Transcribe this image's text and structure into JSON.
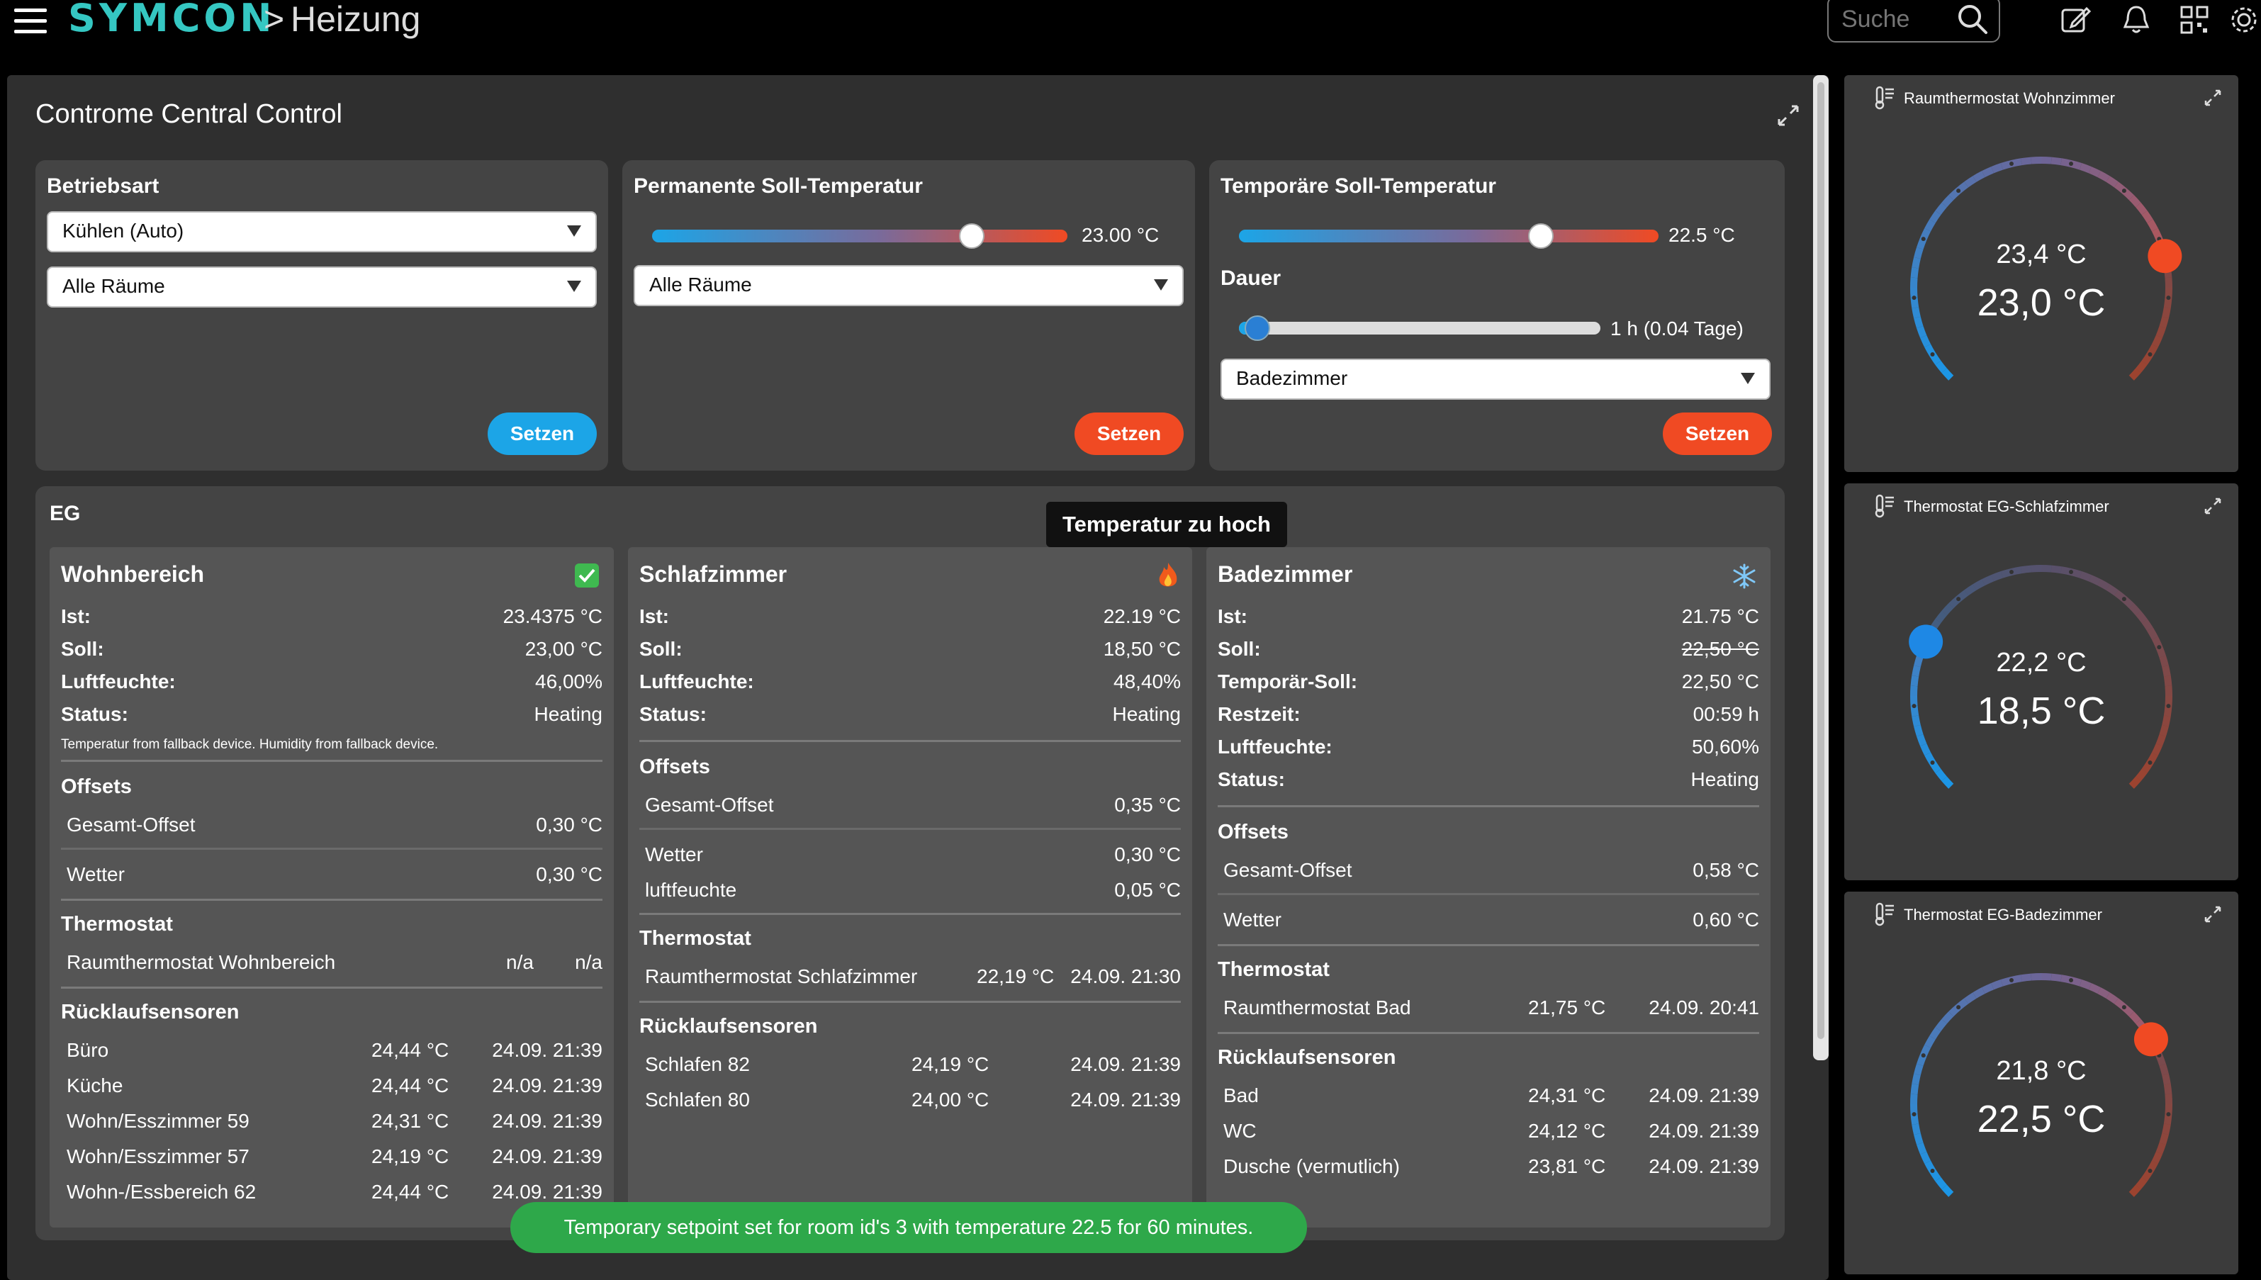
{
  "header": {
    "logo": "SYMCON",
    "breadcrumb_sep": ">",
    "breadcrumb": "Heizung",
    "search_placeholder": "Suche"
  },
  "icons": {
    "menu": "menu-icon",
    "search": "search-icon",
    "edit": "edit-icon",
    "bell": "bell-icon",
    "qr": "qr-code-icon",
    "settings": "gear-icon",
    "expand": "expand-icon",
    "thermometer": "thermometer-icon",
    "ok": "check-mark-icon",
    "fire": "fire-icon",
    "snow": "snowflake-icon"
  },
  "colors": {
    "accent_blue": "#1ca5e7",
    "accent_red": "#f04a23",
    "logo": "#35c7c2",
    "toast": "#2ea84a"
  },
  "main": {
    "title": "Controme Central Control",
    "betriebsart": {
      "title": "Betriebsart",
      "mode_select": "Kühlen (Auto)",
      "room_select": "Alle Räume",
      "button": "Setzen"
    },
    "permanent": {
      "title": "Permanente Soll-Temperatur",
      "value": "23.00 °C",
      "slider_fraction": 0.77,
      "room_select": "Alle Räume",
      "button": "Setzen"
    },
    "temporary": {
      "title": "Temporäre Soll-Temperatur",
      "value": "22.5 °C",
      "slider_fraction": 0.72,
      "duration_title": "Dauer",
      "duration_value": "1 h (0.04 Tage)",
      "duration_fraction": 0.05,
      "room_select": "Badezimmer",
      "button": "Setzen"
    }
  },
  "eg": {
    "title": "EG",
    "tooltip": "Temperatur zu hoch",
    "rooms": [
      {
        "title": "Wohnbereich",
        "status_icon": "check-mark-icon",
        "rows": [
          {
            "k": "Ist:",
            "v": "23.4375 °C"
          },
          {
            "k": "Soll:",
            "v": "23,00 °C"
          },
          {
            "k": "Luftfeuchte:",
            "v": "46,00%"
          },
          {
            "k": "Status:",
            "v": "Heating"
          }
        ],
        "note": "Temperatur from fallback device. Humidity from fallback device.",
        "offsets_title": "Offsets",
        "offsets": [
          {
            "k": "Gesamt-Offset",
            "v": "0,30 °C"
          },
          {
            "k": "Wetter",
            "v": "0,30 °C"
          }
        ],
        "thermostat_title": "Thermostat",
        "thermostat": {
          "name": "Raumthermostat Wohnbereich",
          "temp": "n/a",
          "time": "n/a"
        },
        "sensors_title": "Rücklaufsensoren",
        "sensors": [
          {
            "name": "Büro",
            "temp": "24,44 °C",
            "time": "24.09. 21:39"
          },
          {
            "name": "Küche",
            "temp": "24,44 °C",
            "time": "24.09. 21:39"
          },
          {
            "name": "Wohn/Esszimmer 59",
            "temp": "24,31 °C",
            "time": "24.09. 21:39"
          },
          {
            "name": "Wohn/Esszimmer 57",
            "temp": "24,19 °C",
            "time": "24.09. 21:39"
          },
          {
            "name": "Wohn-/Essbereich 62",
            "temp": "24,44 °C",
            "time": "24.09. 21:39"
          }
        ]
      },
      {
        "title": "Schlafzimmer",
        "status_icon": "fire-icon",
        "rows": [
          {
            "k": "Ist:",
            "v": "22.19 °C"
          },
          {
            "k": "Soll:",
            "v": "18,50 °C"
          },
          {
            "k": "Luftfeuchte:",
            "v": "48,40%"
          },
          {
            "k": "Status:",
            "v": "Heating"
          }
        ],
        "offsets_title": "Offsets",
        "offsets": [
          {
            "k": "Gesamt-Offset",
            "v": "0,35 °C"
          },
          {
            "k": "Wetter",
            "v": "0,30 °C"
          },
          {
            "k": "luftfeuchte",
            "v": "0,05 °C"
          }
        ],
        "thermostat_title": "Thermostat",
        "thermostat": {
          "name": "Raumthermostat Schlafzimmer",
          "temp": "22,19 °C",
          "time": "24.09. 21:30"
        },
        "sensors_title": "Rücklaufsensoren",
        "sensors": [
          {
            "name": "Schlafen 82",
            "temp": "24,19 °C",
            "time": "24.09. 21:39"
          },
          {
            "name": "Schlafen 80",
            "temp": "24,00 °C",
            "time": "24.09. 21:39"
          }
        ]
      },
      {
        "title": "Badezimmer",
        "status_icon": "snowflake-icon",
        "rows": [
          {
            "k": "Ist:",
            "v": "21.75 °C"
          },
          {
            "k": "Soll:",
            "v": "22,50 °C"
          },
          {
            "k": "Temporär-Soll:",
            "v": "22,50 °C"
          },
          {
            "k": "Restzeit:",
            "v": "00:59 h"
          },
          {
            "k": "Luftfeuchte:",
            "v": "50,60%"
          },
          {
            "k": "Status:",
            "v": "Heating"
          }
        ],
        "offsets_title": "Offsets",
        "offsets": [
          {
            "k": "Gesamt-Offset",
            "v": "0,58 °C"
          },
          {
            "k": "Wetter",
            "v": "0,60 °C"
          }
        ],
        "thermostat_title": "Thermostat",
        "thermostat": {
          "name": "Raumthermostat Bad",
          "temp": "21,75 °C",
          "time": "24.09. 20:41"
        },
        "sensors_title": "Rücklaufsensoren",
        "sensors": [
          {
            "name": "Bad",
            "temp": "24,31 °C",
            "time": "24.09. 21:39"
          },
          {
            "name": "WC",
            "temp": "24,12 °C",
            "time": "24.09. 21:39"
          },
          {
            "name": "Dusche (vermutlich)",
            "temp": "23,81 °C",
            "time": "24.09. 21:39"
          }
        ]
      }
    ]
  },
  "toast": "Temporary setpoint set for room id's 3 with temperature 22.5 for 60 minutes.",
  "gauges": [
    {
      "title": "Raumthermostat Wohnzimmer",
      "ist": "23,4 °C",
      "soll": "23,0 °C",
      "fraction": 0.78
    },
    {
      "title": "Thermostat EG-Schlafzimmer",
      "ist": "22,2 °C",
      "soll": "18,5 °C",
      "fraction": 0.26
    },
    {
      "title": "Thermostat EG-Badezimmer",
      "ist": "21,8 °C",
      "soll": "22,5 °C",
      "fraction": 0.72
    }
  ]
}
